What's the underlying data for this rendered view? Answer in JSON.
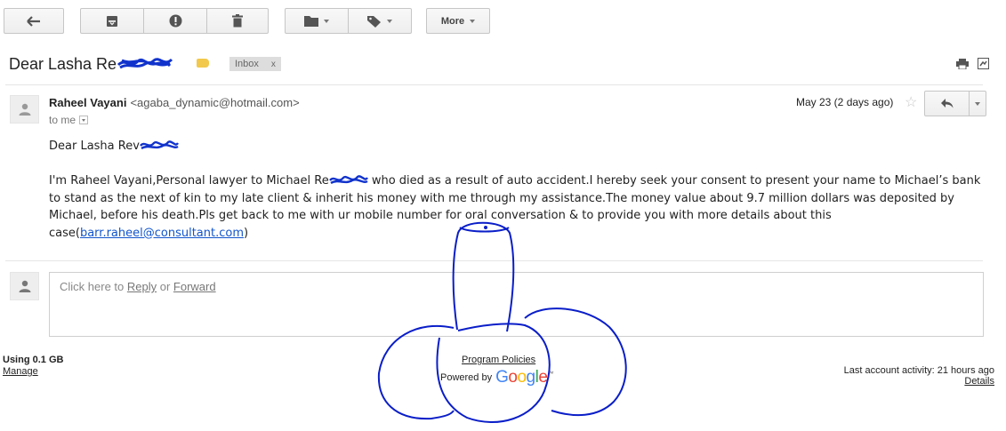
{
  "toolbar": {
    "back_icon": "arrow-left-icon",
    "archive_icon": "archive-icon",
    "spam_icon": "report-spam-icon",
    "delete_icon": "trash-icon",
    "move_icon": "folder-icon",
    "labels_icon": "label-tag-icon",
    "more_label": "More"
  },
  "subject": {
    "text": "Dear Lasha Re",
    "label_chip": "Inbox",
    "label_chip_close": "x"
  },
  "message": {
    "sender_name": "Raheel Vayani",
    "sender_email": "<agaba_dynamic@hotmail.com>",
    "to": "to me",
    "date": "May 23 (2 days ago)",
    "star": "☆",
    "greeting": "Dear Lasha Rev",
    "body_part1": "I'm Raheel Vayani,Personal lawyer to Michael Re",
    "body_part2": " who died as a result of auto accident.I hereby seek your consent to present your name to Michael’s bank to stand as the next of kin to my late client & inherit his money with me through my assistance.The money value about 9.7 million dollars was deposited by Michael, before his death.Pls get back to me with ur mobile number for oral conversation & to provide you with more details about this case(",
    "body_link": "barr.raheel@consultant.com",
    "body_end": ")"
  },
  "reply": {
    "prefix": "Click here to ",
    "reply_link": "Reply",
    "or": " or ",
    "forward_link": "Forward"
  },
  "footer": {
    "storage": "Using 0.1 GB",
    "manage": "Manage",
    "program_policies": "Program Policies",
    "powered_by": "Powered by",
    "google_letters": [
      "G",
      "o",
      "o",
      "g",
      "l",
      "e"
    ],
    "google_colors": [
      "#4285F4",
      "#EA4335",
      "#FBBC05",
      "#4285F4",
      "#34A853",
      "#EA4335"
    ],
    "tm": "™",
    "last_activity": "Last account activity: 21 hours ago",
    "details": "Details"
  },
  "colors": {
    "scribble_blue": "#1133cc",
    "link_blue": "#1155cc",
    "label_yellow": "#f2c94c"
  }
}
